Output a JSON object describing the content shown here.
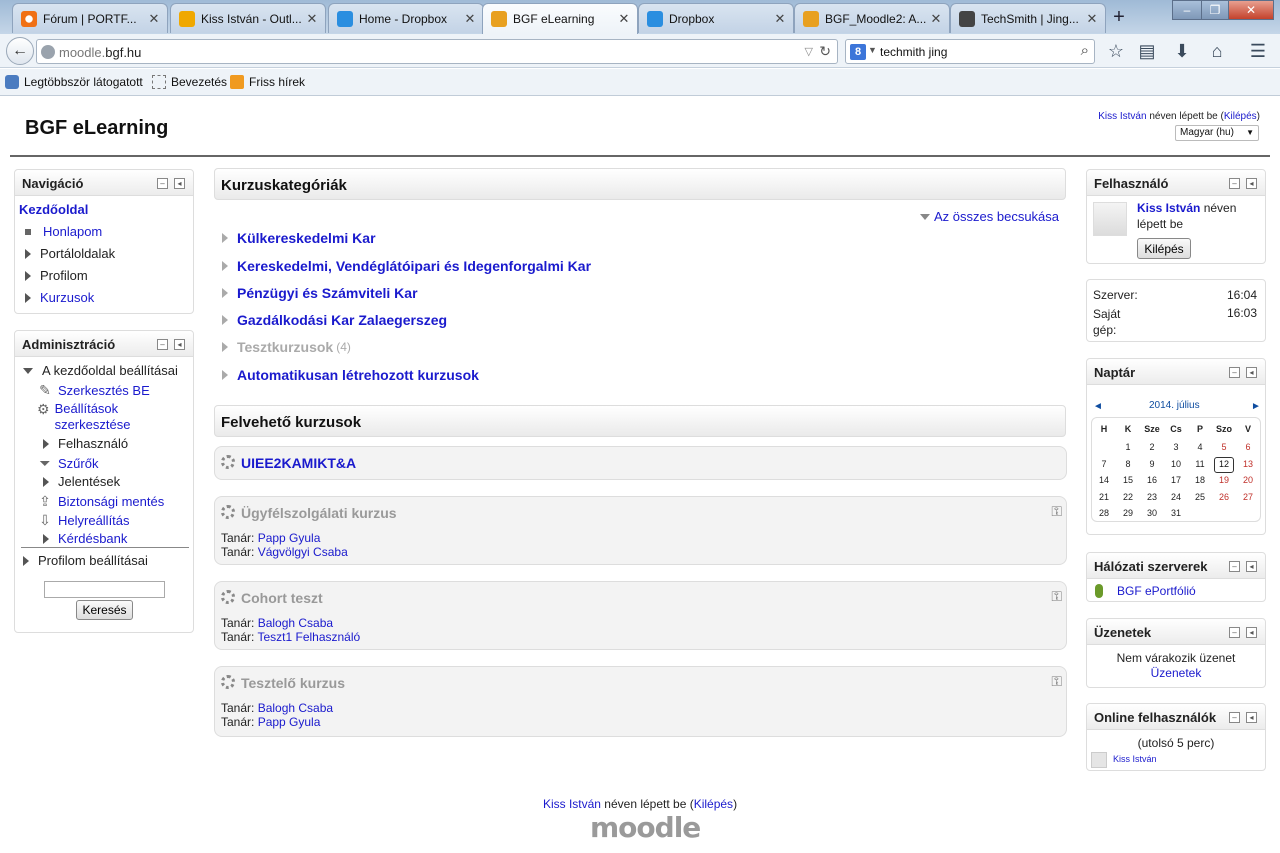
{
  "browser": {
    "tabs": [
      {
        "label": "Fórum | PORTF...",
        "favicon_color": "#f07014"
      },
      {
        "label": "Kiss István - Outl...",
        "favicon_color": "#f0a800"
      },
      {
        "label": "Home - Dropbox",
        "favicon_color": "#2a8ee0"
      },
      {
        "label": "BGF eLearning",
        "favicon_color": "#e8a020"
      },
      {
        "label": "Dropbox",
        "favicon_color": "#2a8ee0"
      },
      {
        "label": "BGF_Moodle2: A...",
        "favicon_color": "#e8a020"
      },
      {
        "label": "TechSmith | Jing...",
        "favicon_color": "#444"
      }
    ],
    "new_tab": "+",
    "url_prefix": "moodle.",
    "url_domain": "bgf.hu",
    "search_engine_letter": "8",
    "search_value": "techmith jing",
    "bookmarks": [
      "Legtöbbször látogatott",
      "Bevezetés",
      "Friss hírek"
    ],
    "window_controls": [
      "–",
      "❐",
      "✕"
    ]
  },
  "site": {
    "name": "BGF eLearning",
    "user": "Kiss István",
    "logged_in_text": " néven lépett be (",
    "logout": "Kilépés",
    "close_paren": ")",
    "lang": "Magyar (hu)"
  },
  "navigation": {
    "title": "Navigáció",
    "home": "Kezdőoldal",
    "items": [
      "Honlapom",
      "Portáloldalak",
      "Profilom",
      "Kurzusok"
    ]
  },
  "admin": {
    "title": "Adminisztráció",
    "group": "A kezdőoldal beállításai",
    "items": [
      "Szerkesztés BE",
      "Beállítások szerkesztése",
      "Felhasználó",
      "Szűrők",
      "Jelentések",
      "Biztonsági mentés",
      "Helyreállítás",
      "Kérdésbank"
    ],
    "profile_settings": "Profilom beállításai",
    "search_button": "Keresés"
  },
  "categories": {
    "title": "Kurzuskategóriák",
    "collapse_all": "Az összes becsukása",
    "items": [
      "Külkereskedelmi Kar",
      "Kereskedelmi, Vendéglátóipari és Idegenforgalmi Kar",
      "Pénzügyi és Számviteli Kar",
      "Gazdálkodási Kar Zalaegerszeg",
      "Tesztkurzusok",
      "Automatikusan létrehozott kurzusok"
    ],
    "test_count": "(4)"
  },
  "courses": {
    "title": "Felvehető kurzusok",
    "teacher_label": "Tanár: ",
    "items": [
      {
        "name": "UIEE2KAMIKT&A",
        "teachers": []
      },
      {
        "name": "Ügyfélszolgálati kurzus",
        "teachers": [
          "Papp Gyula",
          "Vágvölgyi Csaba"
        ]
      },
      {
        "name": "Cohort teszt",
        "teachers": [
          "Balogh Csaba",
          "Teszt1 Felhasználó"
        ]
      },
      {
        "name": "Tesztelő kurzus",
        "teachers": [
          "Balogh Csaba",
          "Papp Gyula"
        ]
      }
    ]
  },
  "user_block": {
    "title": "Felhasználó",
    "name": "Kiss István",
    "suffix": " néven lépett be",
    "logout_button": "Kilépés"
  },
  "time_block": {
    "server_label": "Szerver:",
    "server_time": "16:04",
    "own_label": "Saját gép:",
    "own_time": "16:03"
  },
  "calendar": {
    "title": "Naptár",
    "month": "2014. július",
    "prev": "◄",
    "next": "►",
    "weekdays": [
      "H",
      "K",
      "Sze",
      "Cs",
      "P",
      "Szo",
      "V"
    ],
    "weeks": [
      [
        "",
        "1",
        "2",
        "3",
        "4",
        "5",
        "6"
      ],
      [
        "7",
        "8",
        "9",
        "10",
        "11",
        "12",
        "13"
      ],
      [
        "14",
        "15",
        "16",
        "17",
        "18",
        "19",
        "20"
      ],
      [
        "21",
        "22",
        "23",
        "24",
        "25",
        "26",
        "27"
      ],
      [
        "28",
        "29",
        "30",
        "31",
        "",
        "",
        ""
      ]
    ],
    "today": "12",
    "weekend_color": "#c0302a"
  },
  "network": {
    "title": "Hálózati szerverek",
    "item": "BGF ePortfólió"
  },
  "messages": {
    "title": "Üzenetek",
    "text": "Nem várakozik üzenet",
    "link": "Üzenetek"
  },
  "online": {
    "title": "Online felhasználók",
    "period": "(utolsó 5 perc)",
    "user": "Kiss István"
  },
  "footer": {
    "user": "Kiss István",
    "text": " néven lépett be (",
    "logout": "Kilépés",
    "close": ")",
    "logo": "moodle"
  },
  "colors": {
    "link": "#1a1acd",
    "accent": "#0f4da0"
  }
}
